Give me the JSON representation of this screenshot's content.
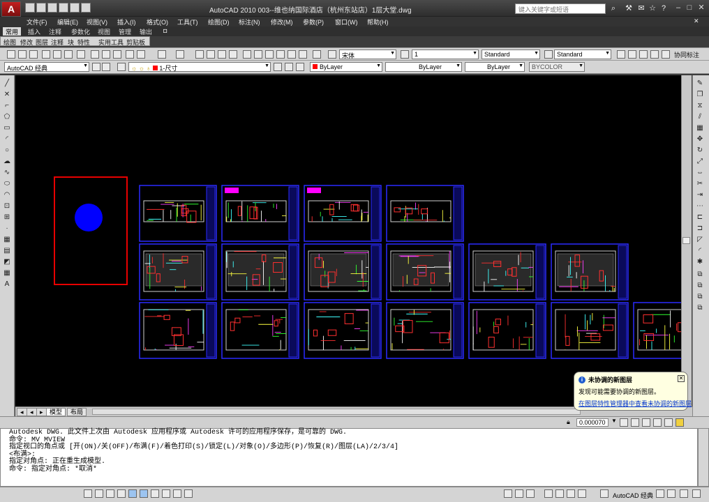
{
  "titlebar": {
    "app_logo": "A",
    "title": "AutoCAD 2010    003--维也纳国际酒店（杭州东站店）1层大堂.dwg",
    "search_placeholder": "键入关键字或短语"
  },
  "menus": [
    "文件(F)",
    "编辑(E)",
    "视图(V)",
    "插入(I)",
    "格式(O)",
    "工具(T)",
    "绘图(D)",
    "标注(N)",
    "修改(M)",
    "参数(P)",
    "窗口(W)",
    "帮助(H)"
  ],
  "ribbon_tabs": [
    "常用",
    "插入",
    "注释",
    "参数化",
    "视图",
    "管理",
    "输出"
  ],
  "ribbon_panels": [
    "绘图",
    "修改",
    "图层",
    "注释",
    "块",
    "特性",
    "实用工具",
    "剪贴板"
  ],
  "toolbar1": {
    "text_style": "宋体",
    "text_height": "1",
    "dim_style": "Standard",
    "table_style": "Standard",
    "extra_label": "协同标注"
  },
  "toolbar2": {
    "workspace": "AutoCAD 经典",
    "layer": "1-尺寸",
    "color": "ByLayer",
    "linetype": "ByLayer",
    "lineweight": "ByLayer",
    "plotstyle": "BYCOLOR"
  },
  "layout_tabs": [
    "模型",
    "布局"
  ],
  "status": {
    "scale": "0.000070",
    "workspace_label": "AutoCAD 经典"
  },
  "notification": {
    "title": "未协调的新图层",
    "line1": "发现可能需要协调的新图层。",
    "link": "在图层特性管理器中查看未协调的新图层"
  },
  "command_lines": [
    "Autodesk DWG.  此文件上次由 Autodesk 应用程序或 Autodesk 许可的应用程序保存，是可靠的 DWG.",
    "命令: MV MVIEW",
    "指定视口的角点或 [开(ON)/关(OFF)/布满(F)/着色打印(S)/锁定(L)/对象(O)/多边形(P)/恢复(R)/图层(LA)/2/3/4]",
    "<布满>:",
    "指定对角点: 正在重生成模型.",
    "命令: 指定对角点: *取消*"
  ],
  "colors": {
    "canvas": "#000000",
    "viewport_border": "#e80000",
    "circle_fill": "#0000ff",
    "sheet_border": "#2b2bff",
    "accent_red": "#ff3030"
  }
}
